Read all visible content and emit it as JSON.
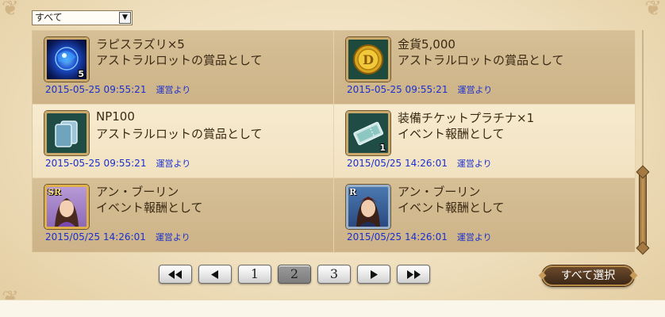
{
  "filter": {
    "selected": "すべて"
  },
  "items": [
    {
      "name": "ラピスラズリ×5",
      "desc": "アストラルロットの賞品として",
      "date": "2015-05-25 09:55:21",
      "source": "運営より",
      "icon": "lapis-lazuli-icon",
      "qty": "5",
      "rank": ""
    },
    {
      "name": "金貨5,000",
      "desc": "アストラルロットの賞品として",
      "date": "2015-05-25 09:55:21",
      "source": "運営より",
      "icon": "gold-coin-icon",
      "qty": "",
      "rank": ""
    },
    {
      "name": "NP100",
      "desc": "アストラルロットの賞品として",
      "date": "2015-05-25 09:55:21",
      "source": "運営より",
      "icon": "np-cards-icon",
      "qty": "",
      "rank": ""
    },
    {
      "name": "装備チケットプラチナ×1",
      "desc": "イベント報酬として",
      "date": "2015/05/25 14:26:01",
      "source": "運営より",
      "icon": "platinum-ticket-icon",
      "qty": "1",
      "rank": ""
    },
    {
      "name": "アン・ブーリン",
      "desc": "イベント報酬として",
      "date": "2015/05/25 14:26:01",
      "source": "運営より",
      "icon": "character-portrait-icon",
      "qty": "",
      "rank": "SR"
    },
    {
      "name": "アン・ブーリン",
      "desc": "イベント報酬として",
      "date": "2015/05/25 14:26:01",
      "source": "運営より",
      "icon": "character-portrait-icon",
      "qty": "",
      "rank": "R"
    }
  ],
  "pagination": {
    "pages": [
      "1",
      "2",
      "3"
    ],
    "current": "2",
    "first_icon": "double-left-arrow-icon",
    "prev_icon": "left-arrow-icon",
    "next_icon": "right-arrow-icon",
    "last_icon": "double-right-arrow-icon"
  },
  "select_all_label": "すべて選択",
  "colors": {
    "meta_text": "#1a2fd0",
    "cell_dark": "#d6bf96",
    "cell_light": "#f7ebcf"
  }
}
